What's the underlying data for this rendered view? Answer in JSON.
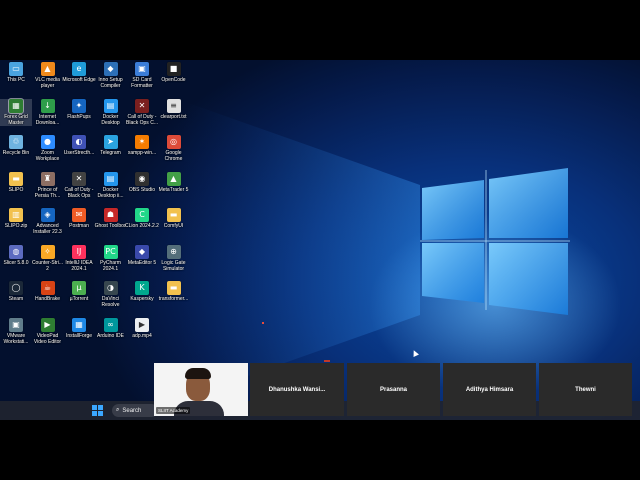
{
  "desktop": {
    "icons": [
      {
        "label": "This PC",
        "color": "#4aa3df",
        "glyph": "▭"
      },
      {
        "label": "VLC media player",
        "color": "#f08a1c",
        "glyph": "▲"
      },
      {
        "label": "Microsoft Edge",
        "color": "#1f9bd8",
        "glyph": "e"
      },
      {
        "label": "Inno Setup Compiler",
        "color": "#2c6fb7",
        "glyph": "◆"
      },
      {
        "label": "SD Card Formatter",
        "color": "#3b7dd8",
        "glyph": "▣"
      },
      {
        "label": "OpenCode",
        "color": "#222222",
        "glyph": "■"
      },
      {
        "label": "Forex Grid Master",
        "color": "#2e7d32",
        "glyph": "▦"
      },
      {
        "label": "Internet Downloa...",
        "color": "#2e9d4a",
        "glyph": "↓"
      },
      {
        "label": "FlashPups",
        "color": "#1565c0",
        "glyph": "✦"
      },
      {
        "label": "Docker Desktop",
        "color": "#2496ed",
        "glyph": "▤"
      },
      {
        "label": "Call of Duty - Black Ops C...",
        "color": "#7a1f1f",
        "glyph": "✕"
      },
      {
        "label": "clearport.txt",
        "color": "#e0e0e0",
        "glyph": "≡"
      },
      {
        "label": "Recycle Bin",
        "color": "#6fb3e0",
        "glyph": "♲"
      },
      {
        "label": "Zoom Workplace",
        "color": "#2d8cff",
        "glyph": "●"
      },
      {
        "label": "UserStrecth...",
        "color": "#3f51b5",
        "glyph": "◐"
      },
      {
        "label": "Telegram",
        "color": "#2aa3e0",
        "glyph": "➤"
      },
      {
        "label": "xampp-win...",
        "color": "#f57c00",
        "glyph": "✶"
      },
      {
        "label": "Google Chrome",
        "color": "#dd4b39",
        "glyph": "◎"
      },
      {
        "label": "SLIPO",
        "color": "#f2c14e",
        "glyph": "▬"
      },
      {
        "label": "Prince of Persia Th...",
        "color": "#8d6e63",
        "glyph": "♜"
      },
      {
        "label": "Call of Duty - Black Ops",
        "color": "#424242",
        "glyph": "✕"
      },
      {
        "label": "Docker Desktop ii...",
        "color": "#2496ed",
        "glyph": "▤"
      },
      {
        "label": "OBS Studio",
        "color": "#303030",
        "glyph": "◉"
      },
      {
        "label": "MetaTrader 5",
        "color": "#43a047",
        "glyph": "▲"
      },
      {
        "label": "SLIPO.zip",
        "color": "#f2c14e",
        "glyph": "▥"
      },
      {
        "label": "Advanced Installer 22.3",
        "color": "#1565c0",
        "glyph": "◈"
      },
      {
        "label": "Postman",
        "color": "#ef5b25",
        "glyph": "✉"
      },
      {
        "label": "Ghost Toolbox",
        "color": "#c62828",
        "glyph": "☗"
      },
      {
        "label": "CLion 2024.2.2",
        "color": "#21d789",
        "glyph": "C"
      },
      {
        "label": "ComfyUI",
        "color": "#f2c14e",
        "glyph": "▬"
      },
      {
        "label": "Slicer 5.8.0",
        "color": "#5c6bc0",
        "glyph": "◍"
      },
      {
        "label": "Counter-Stri... 2",
        "color": "#f9a825",
        "glyph": "✧"
      },
      {
        "label": "IntelliJ IDEA 2024.1",
        "color": "#fe315d",
        "glyph": "IJ"
      },
      {
        "label": "PyCharm 2024.1",
        "color": "#21d789",
        "glyph": "PC"
      },
      {
        "label": "MetaEditor 5",
        "color": "#3949ab",
        "glyph": "◆"
      },
      {
        "label": "Logic Gate Simulator",
        "color": "#546e7a",
        "glyph": "⊕"
      },
      {
        "label": "Steam",
        "color": "#1b2838",
        "glyph": "◯"
      },
      {
        "label": "HandBrake",
        "color": "#d84315",
        "glyph": "☕"
      },
      {
        "label": "µTorrent",
        "color": "#4caf50",
        "glyph": "µ"
      },
      {
        "label": "DaVinci Resolve",
        "color": "#37474f",
        "glyph": "◑"
      },
      {
        "label": "Kaspersky",
        "color": "#00a88e",
        "glyph": "K"
      },
      {
        "label": "transformer...",
        "color": "#f2c14e",
        "glyph": "▬"
      },
      {
        "label": "VMware Workstati...",
        "color": "#607d8b",
        "glyph": "▣"
      },
      {
        "label": "VideoPad Video Editor",
        "color": "#2e7d32",
        "glyph": "▶"
      },
      {
        "label": "InstallForge",
        "color": "#1e88e5",
        "glyph": "▦"
      },
      {
        "label": "Arduino IDE",
        "color": "#00979d",
        "glyph": "∞"
      },
      {
        "label": "adp.mp4",
        "color": "#eceff1",
        "glyph": "▶"
      }
    ]
  },
  "taskbar": {
    "search_placeholder": "Search",
    "search_icon": "search-icon",
    "start_icon": "windows-start-icon"
  },
  "meeting": {
    "self_name": "SLIIT Academy",
    "participants": [
      {
        "name": "Dhanushka  Wansi..."
      },
      {
        "name": "Prasanna"
      },
      {
        "name": "Adithya Himsara"
      },
      {
        "name": "Thewni"
      }
    ]
  }
}
